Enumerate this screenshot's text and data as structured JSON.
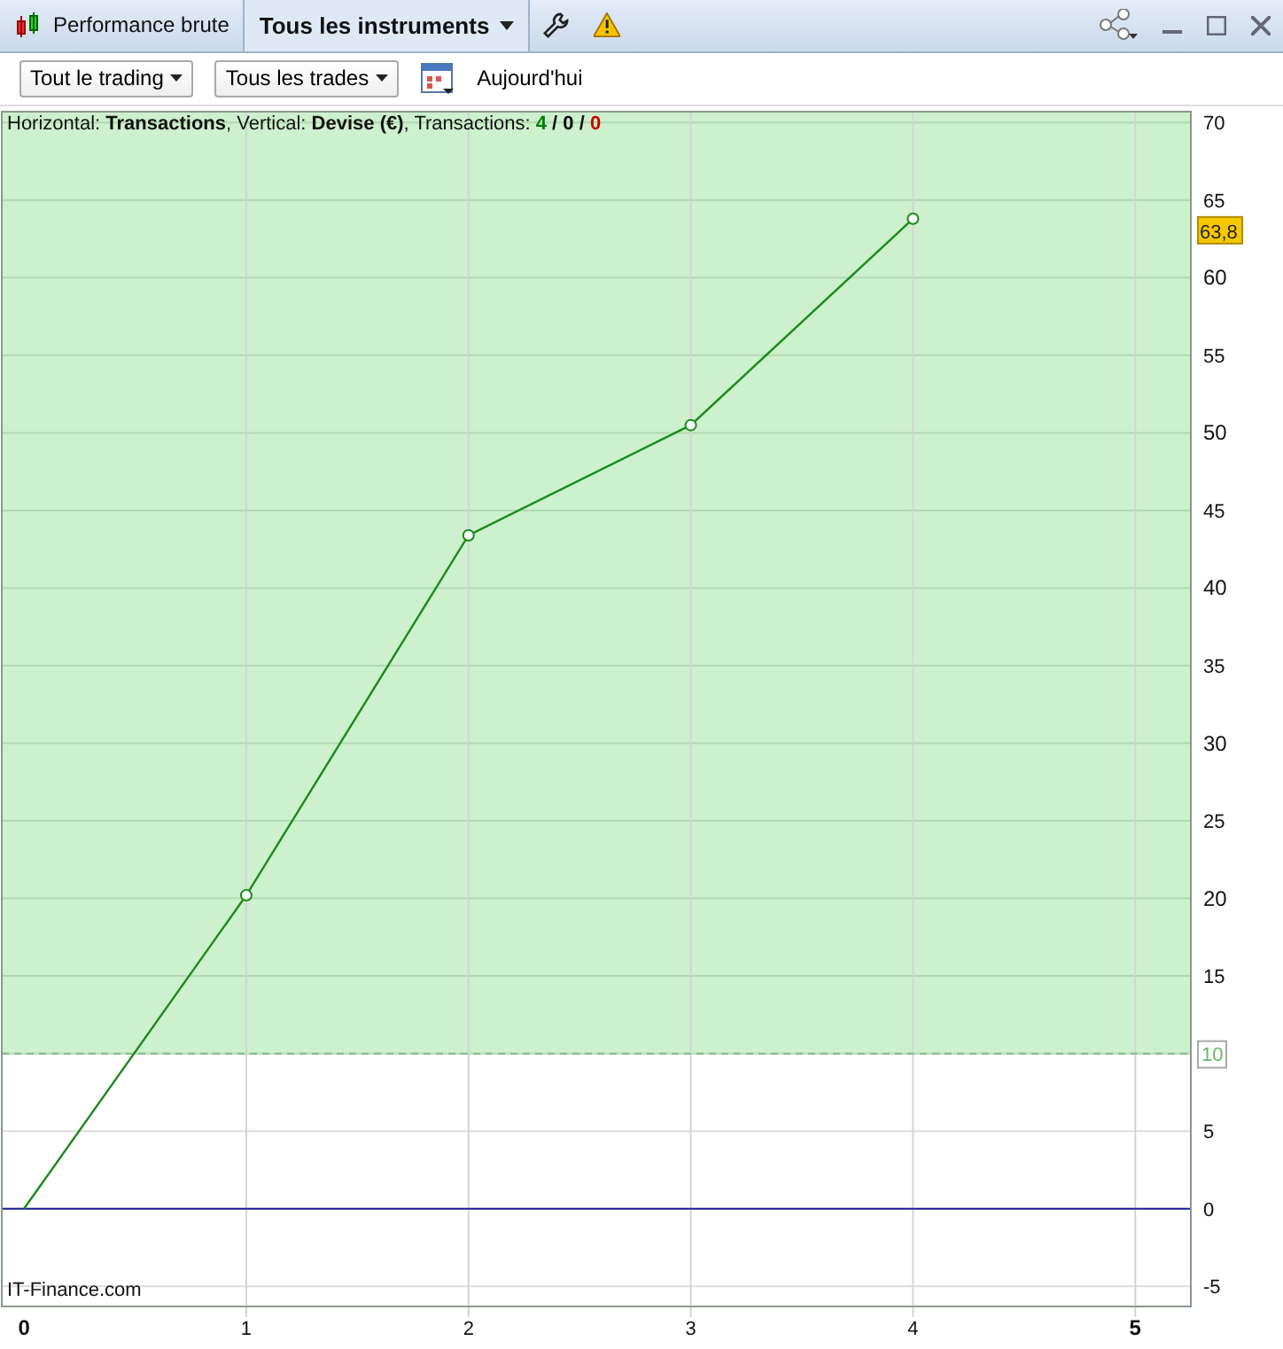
{
  "title_bar": {
    "tabs": [
      {
        "label": "Performance brute",
        "selected": false
      },
      {
        "label": "Tous les instruments",
        "selected": true
      }
    ]
  },
  "toolbar": {
    "dropdowns": [
      "Tout le trading",
      "Tous les trades"
    ],
    "date_label": "Aujourd'hui"
  },
  "chart_info": {
    "text": "Horizontal: **Transactions**, Vertical: **Devise (€)**, Transactions: ",
    "counts": [
      {
        "value": "4",
        "color": "#008000"
      },
      {
        "value": "0",
        "color": "#000000"
      },
      {
        "value": "0",
        "color": "#cc0000"
      }
    ],
    "separator": " / "
  },
  "watermark_label": "IT-Finance.com",
  "chart_data": {
    "type": "line",
    "grid": true,
    "x": [
      0,
      1,
      2,
      3,
      4
    ],
    "series": [
      {
        "color": "#1a8a1a",
        "marker": "o",
        "values": [
          0,
          20.2,
          43.4,
          50.5,
          63.8
        ]
      }
    ],
    "xlim": [
      -0.1,
      5.25
    ],
    "ylim": [
      -6.3,
      70.7
    ],
    "xticks": [
      0,
      1,
      2,
      3,
      4,
      5
    ],
    "yticks": [
      -5,
      0,
      5,
      10,
      15,
      20,
      25,
      30,
      35,
      40,
      45,
      50,
      55,
      60,
      65,
      70
    ],
    "ref_lines": [
      {
        "axis": "y",
        "value": 10,
        "color": "#88b888",
        "label": "10"
      },
      {
        "axis": "y",
        "value": 0,
        "color": "#1a1aa0"
      }
    ],
    "bands": [
      {
        "axis": "y",
        "from": 10,
        "to": 70.7,
        "color": "#cdf0cd"
      }
    ],
    "annotations": [
      "63,8"
    ]
  }
}
